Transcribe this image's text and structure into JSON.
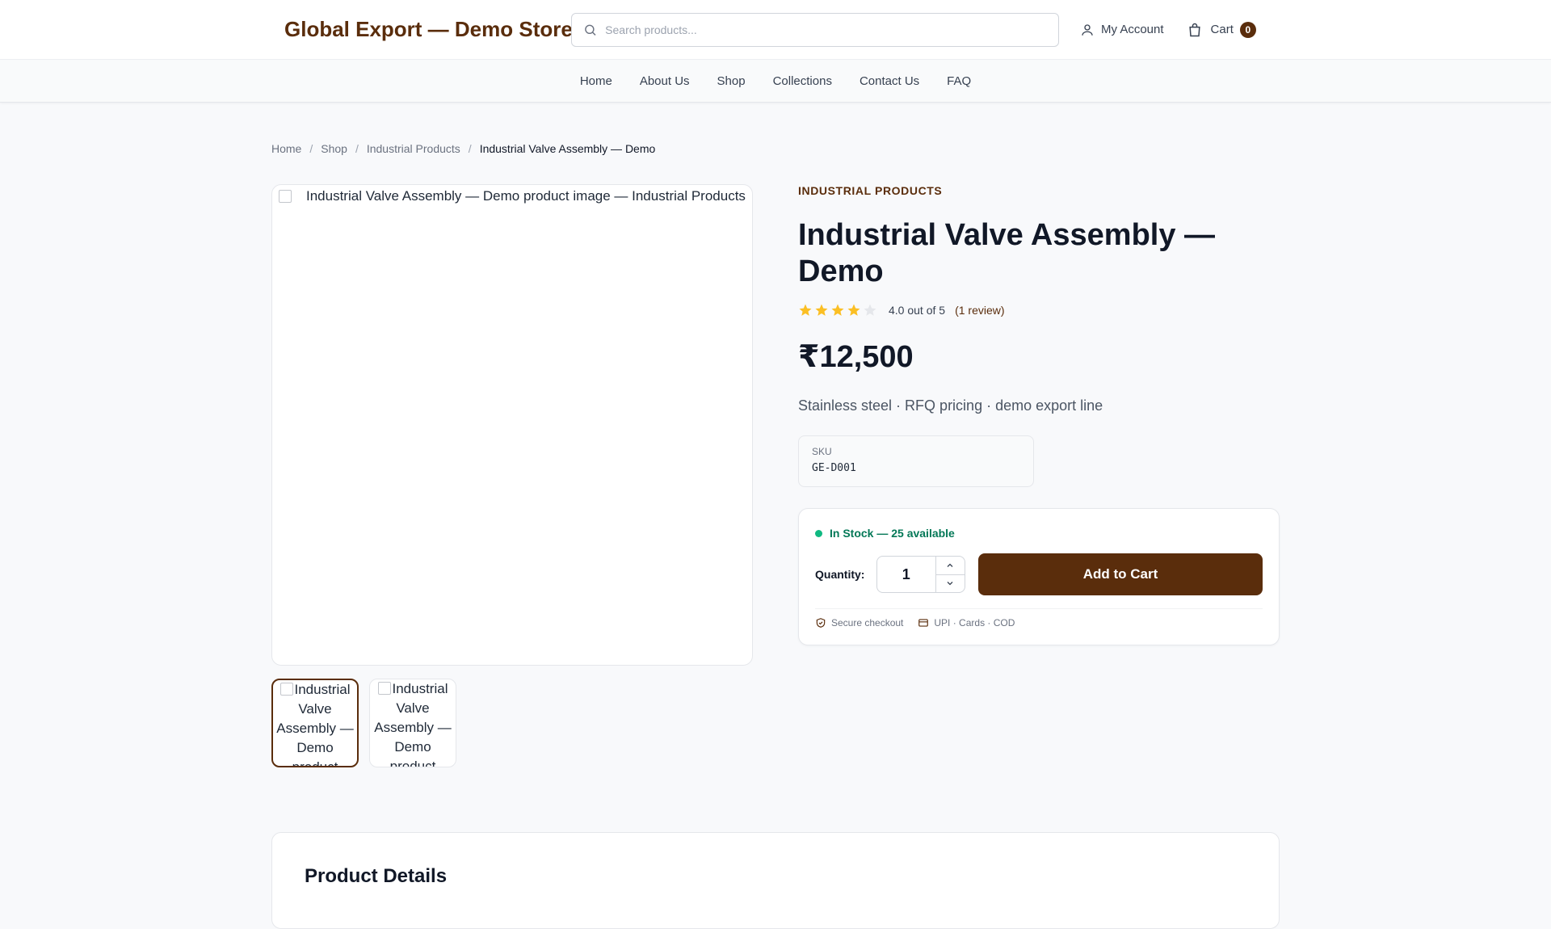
{
  "header": {
    "logo": "Global Export — Demo Store",
    "search_placeholder": "Search products...",
    "account_label": "My Account",
    "cart_label": "Cart",
    "cart_count": "0"
  },
  "nav": {
    "items": [
      "Home",
      "About Us",
      "Shop",
      "Collections",
      "Contact Us",
      "FAQ"
    ]
  },
  "breadcrumb": {
    "items": [
      "Home",
      "Shop",
      "Industrial Products"
    ],
    "current": "Industrial Valve Assembly — Demo"
  },
  "gallery": {
    "main_alt": "Industrial Valve Assembly — Demo product image — Industrial Products",
    "thumbs": [
      {
        "alt": "Industrial Valve Assembly — Demo product",
        "active": true
      },
      {
        "alt": "Industrial Valve Assembly — Demo product",
        "active": false
      }
    ]
  },
  "product": {
    "category": "INDUSTRIAL PRODUCTS",
    "title": "Industrial Valve Assembly — Demo",
    "rating_value": 4,
    "rating_max": 5,
    "rating_text": "4.0 out of 5",
    "review_text": "(1 review)",
    "price": "₹12,500",
    "tagline": "Stainless steel · RFQ pricing · demo export line",
    "sku_label": "SKU",
    "sku_value": "GE-D001"
  },
  "buy_box": {
    "stock_text": "In Stock — 25 available",
    "quantity_label": "Quantity:",
    "quantity_value": "1",
    "add_to_cart": "Add to Cart",
    "trust_secure": "Secure checkout",
    "trust_payment": "UPI · Cards · COD"
  },
  "details": {
    "heading": "Product Details"
  },
  "colors": {
    "brand": "#5a2d0c",
    "star": "#fbbf24",
    "stock": "#047857"
  }
}
